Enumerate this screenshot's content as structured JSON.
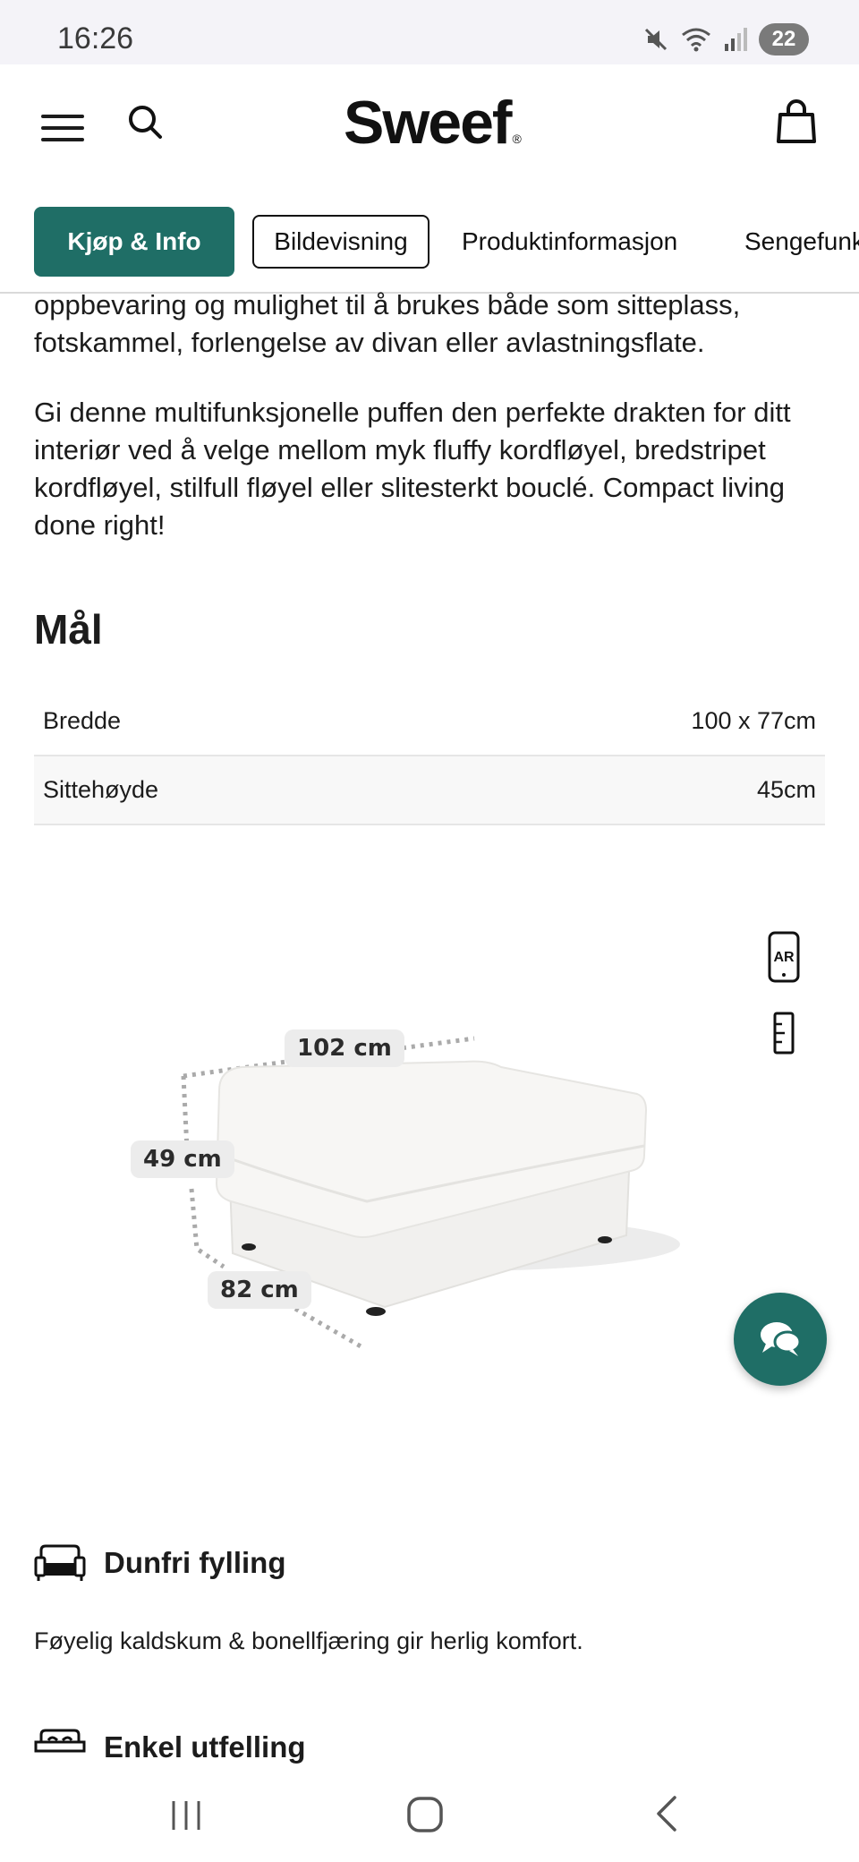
{
  "status_bar": {
    "time": "16:26",
    "battery": "22"
  },
  "header": {
    "logo": "Sweef",
    "logo_mark": "®"
  },
  "tabs": [
    {
      "label": "Kjøp & Info"
    },
    {
      "label": "Bildevisning"
    },
    {
      "label": "Produktinformasjon"
    },
    {
      "label": "Sengefunk"
    }
  ],
  "description": {
    "paragraph_1": "oppbevaring og mulighet til å brukes både som sitteplass, fotskammel, forlengelse av divan eller avlastningsflate.",
    "paragraph_2": "Gi denne multifunksjonelle puffen den perfekte drakten for ditt interiør ved å velge mellom myk fluffy kordfløyel, bredstripet kordfløyel, stilfull fløyel eller slitesterkt bouclé. Compact living done right!"
  },
  "dimensions_section": {
    "title": "Mål",
    "rows": [
      {
        "label": "Bredde",
        "value": "100 x 77cm"
      },
      {
        "label": "Sittehøyde",
        "value": "45cm"
      }
    ]
  },
  "product_view": {
    "ar_label": "AR",
    "width_label": "102 cm",
    "height_label": "49 cm",
    "depth_label": "82 cm"
  },
  "features": [
    {
      "icon": "sofa-icon",
      "title": "Dunfri fylling",
      "description": "Føyelig kaldskum & bonellfjæring gir herlig komfort."
    },
    {
      "icon": "sofa-bed-icon",
      "title": "Enkel utfelling",
      "description": ""
    }
  ],
  "colors": {
    "accent": "#1f6e66",
    "text": "#1c1c1c",
    "divider": "#e6e6e6"
  }
}
